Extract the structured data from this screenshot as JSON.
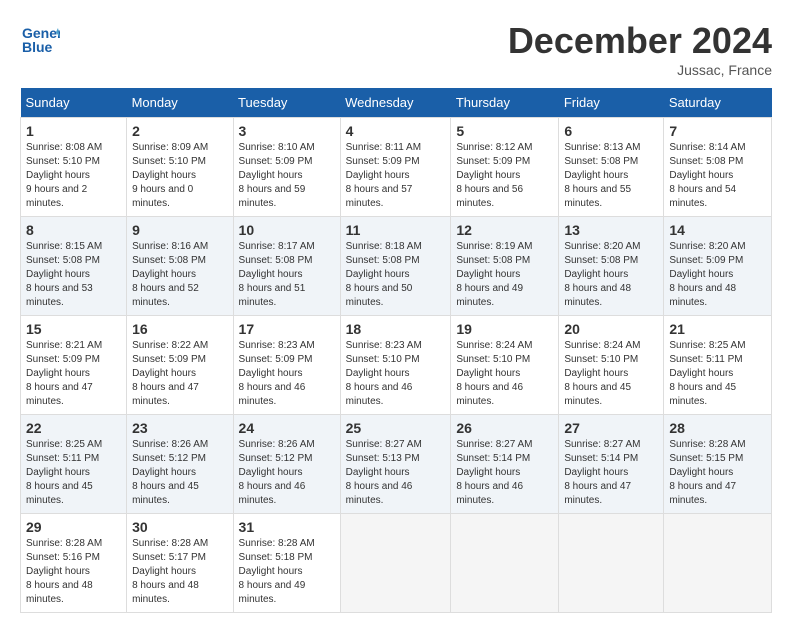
{
  "logo": {
    "line1": "General",
    "line2": "Blue"
  },
  "header": {
    "month": "December 2024",
    "location": "Jussac, France"
  },
  "days_of_week": [
    "Sunday",
    "Monday",
    "Tuesday",
    "Wednesday",
    "Thursday",
    "Friday",
    "Saturday"
  ],
  "weeks": [
    [
      {
        "day": "1",
        "sunrise": "8:08 AM",
        "sunset": "5:10 PM",
        "daylight": "9 hours and 2 minutes."
      },
      {
        "day": "2",
        "sunrise": "8:09 AM",
        "sunset": "5:10 PM",
        "daylight": "9 hours and 0 minutes."
      },
      {
        "day": "3",
        "sunrise": "8:10 AM",
        "sunset": "5:09 PM",
        "daylight": "8 hours and 59 minutes."
      },
      {
        "day": "4",
        "sunrise": "8:11 AM",
        "sunset": "5:09 PM",
        "daylight": "8 hours and 57 minutes."
      },
      {
        "day": "5",
        "sunrise": "8:12 AM",
        "sunset": "5:09 PM",
        "daylight": "8 hours and 56 minutes."
      },
      {
        "day": "6",
        "sunrise": "8:13 AM",
        "sunset": "5:08 PM",
        "daylight": "8 hours and 55 minutes."
      },
      {
        "day": "7",
        "sunrise": "8:14 AM",
        "sunset": "5:08 PM",
        "daylight": "8 hours and 54 minutes."
      }
    ],
    [
      {
        "day": "8",
        "sunrise": "8:15 AM",
        "sunset": "5:08 PM",
        "daylight": "8 hours and 53 minutes."
      },
      {
        "day": "9",
        "sunrise": "8:16 AM",
        "sunset": "5:08 PM",
        "daylight": "8 hours and 52 minutes."
      },
      {
        "day": "10",
        "sunrise": "8:17 AM",
        "sunset": "5:08 PM",
        "daylight": "8 hours and 51 minutes."
      },
      {
        "day": "11",
        "sunrise": "8:18 AM",
        "sunset": "5:08 PM",
        "daylight": "8 hours and 50 minutes."
      },
      {
        "day": "12",
        "sunrise": "8:19 AM",
        "sunset": "5:08 PM",
        "daylight": "8 hours and 49 minutes."
      },
      {
        "day": "13",
        "sunrise": "8:20 AM",
        "sunset": "5:08 PM",
        "daylight": "8 hours and 48 minutes."
      },
      {
        "day": "14",
        "sunrise": "8:20 AM",
        "sunset": "5:09 PM",
        "daylight": "8 hours and 48 minutes."
      }
    ],
    [
      {
        "day": "15",
        "sunrise": "8:21 AM",
        "sunset": "5:09 PM",
        "daylight": "8 hours and 47 minutes."
      },
      {
        "day": "16",
        "sunrise": "8:22 AM",
        "sunset": "5:09 PM",
        "daylight": "8 hours and 47 minutes."
      },
      {
        "day": "17",
        "sunrise": "8:23 AM",
        "sunset": "5:09 PM",
        "daylight": "8 hours and 46 minutes."
      },
      {
        "day": "18",
        "sunrise": "8:23 AM",
        "sunset": "5:10 PM",
        "daylight": "8 hours and 46 minutes."
      },
      {
        "day": "19",
        "sunrise": "8:24 AM",
        "sunset": "5:10 PM",
        "daylight": "8 hours and 46 minutes."
      },
      {
        "day": "20",
        "sunrise": "8:24 AM",
        "sunset": "5:10 PM",
        "daylight": "8 hours and 45 minutes."
      },
      {
        "day": "21",
        "sunrise": "8:25 AM",
        "sunset": "5:11 PM",
        "daylight": "8 hours and 45 minutes."
      }
    ],
    [
      {
        "day": "22",
        "sunrise": "8:25 AM",
        "sunset": "5:11 PM",
        "daylight": "8 hours and 45 minutes."
      },
      {
        "day": "23",
        "sunrise": "8:26 AM",
        "sunset": "5:12 PM",
        "daylight": "8 hours and 45 minutes."
      },
      {
        "day": "24",
        "sunrise": "8:26 AM",
        "sunset": "5:12 PM",
        "daylight": "8 hours and 46 minutes."
      },
      {
        "day": "25",
        "sunrise": "8:27 AM",
        "sunset": "5:13 PM",
        "daylight": "8 hours and 46 minutes."
      },
      {
        "day": "26",
        "sunrise": "8:27 AM",
        "sunset": "5:14 PM",
        "daylight": "8 hours and 46 minutes."
      },
      {
        "day": "27",
        "sunrise": "8:27 AM",
        "sunset": "5:14 PM",
        "daylight": "8 hours and 47 minutes."
      },
      {
        "day": "28",
        "sunrise": "8:28 AM",
        "sunset": "5:15 PM",
        "daylight": "8 hours and 47 minutes."
      }
    ],
    [
      {
        "day": "29",
        "sunrise": "8:28 AM",
        "sunset": "5:16 PM",
        "daylight": "8 hours and 48 minutes."
      },
      {
        "day": "30",
        "sunrise": "8:28 AM",
        "sunset": "5:17 PM",
        "daylight": "8 hours and 48 minutes."
      },
      {
        "day": "31",
        "sunrise": "8:28 AM",
        "sunset": "5:18 PM",
        "daylight": "8 hours and 49 minutes."
      },
      null,
      null,
      null,
      null
    ]
  ]
}
